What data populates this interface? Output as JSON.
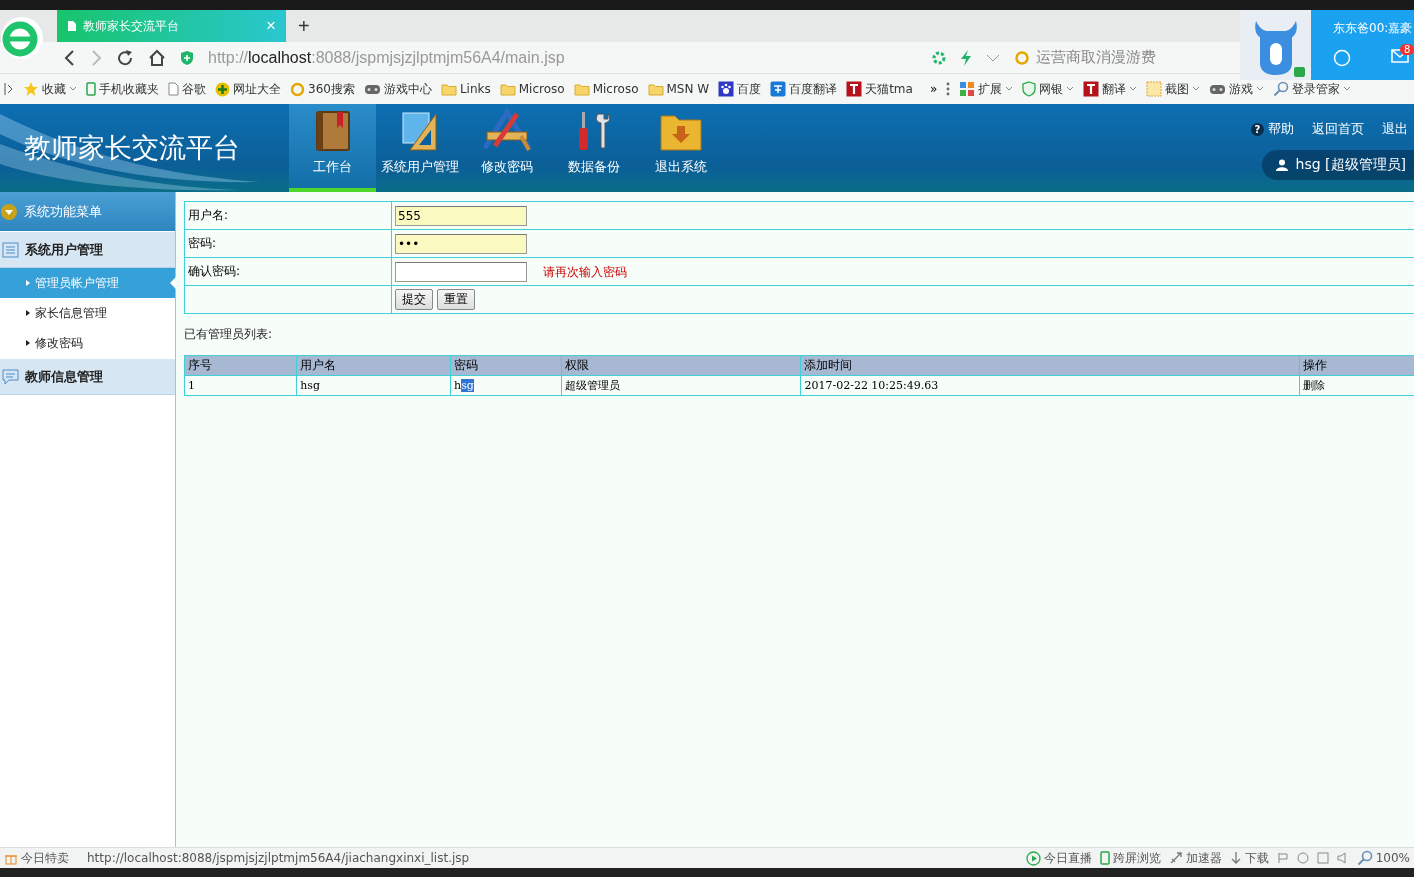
{
  "browser": {
    "tab_title": "教师家长交流平台",
    "new_tab": "+",
    "close": "×",
    "address": {
      "scheme": "http://",
      "host": "localhost",
      "path": ":8088/jspmjsjzjlptmjm56A4/main.jsp"
    },
    "search_hint": "运营商取消漫游费",
    "bookmarks": [
      {
        "kind": "star",
        "label": "收藏",
        "dropdown": true
      },
      {
        "kind": "phone",
        "label": "手机收藏夹",
        "dropdown": false
      },
      {
        "kind": "page",
        "label": "谷歌",
        "dropdown": false
      },
      {
        "kind": "plus",
        "label": "网址大全",
        "dropdown": false
      },
      {
        "kind": "ring",
        "label": "360搜索",
        "dropdown": false
      },
      {
        "kind": "gamepad",
        "label": "游戏中心",
        "dropdown": false
      },
      {
        "kind": "folder",
        "label": "Links",
        "dropdown": false
      },
      {
        "kind": "folder",
        "label": "Microso",
        "dropdown": false
      },
      {
        "kind": "folder",
        "label": "Microso",
        "dropdown": false
      },
      {
        "kind": "folder",
        "label": "MSN W",
        "dropdown": false
      },
      {
        "kind": "paw",
        "label": "百度",
        "dropdown": false
      },
      {
        "kind": "bluesq",
        "label": "百度翻译",
        "dropdown": false
      },
      {
        "kind": "redsq",
        "label": "天猫tma",
        "dropdown": false
      }
    ],
    "more": "»",
    "tools": [
      {
        "kind": "grid",
        "label": "扩展"
      },
      {
        "kind": "shield",
        "label": "网银"
      },
      {
        "kind": "redsq",
        "label": "翻译"
      },
      {
        "kind": "crop",
        "label": "截图"
      },
      {
        "kind": "gamepad",
        "label": "游戏"
      },
      {
        "kind": "search",
        "label": "登录管家"
      }
    ]
  },
  "notification": {
    "name": "东东爸00:嘉豪",
    "badge": "8"
  },
  "app": {
    "title": "教师家长交流平台",
    "nav": [
      {
        "kind": "book",
        "label": "工作台",
        "selected": true
      },
      {
        "kind": "ruler",
        "label": "系统用户管理",
        "selected": false
      },
      {
        "kind": "pencil",
        "label": "修改密码",
        "selected": false
      },
      {
        "kind": "tools",
        "label": "数据备份",
        "selected": false
      },
      {
        "kind": "folder",
        "label": "退出系统",
        "selected": false
      }
    ],
    "help_mark": "?",
    "links": [
      "帮助",
      "返回首页",
      "退出"
    ],
    "user": "hsg [超级管理员]"
  },
  "sidebar": {
    "header": "系统功能菜单",
    "groups": [
      {
        "kind": "list",
        "label": "系统用户管理",
        "children": [
          {
            "label": "管理员帐户管理",
            "selected": true
          },
          {
            "label": "家长信息管理",
            "selected": false
          },
          {
            "label": "修改密码",
            "selected": false
          }
        ]
      },
      {
        "kind": "chat",
        "label": "教师信息管理"
      }
    ]
  },
  "form": {
    "rows": [
      {
        "kind": "input",
        "label": "用户名:",
        "value": "555",
        "filled": true
      },
      {
        "kind": "input",
        "label": "密码:",
        "value": "•••",
        "filled": true
      },
      {
        "kind": "input",
        "label": "确认密码:",
        "value": "",
        "filled": false,
        "hint": "请再次输入密码"
      },
      {
        "kind": "buttons",
        "label": "",
        "buttons": [
          "提交",
          "重置"
        ]
      }
    ]
  },
  "list_title": "已有管理员列表:",
  "table": {
    "columns": [
      "序号",
      "用户名",
      "密码",
      "权限",
      "添加时间",
      "操作"
    ],
    "rows": [
      [
        [
          {
            "text": "1",
            "selected": false
          }
        ],
        [
          {
            "text": "hsg",
            "selected": false
          }
        ],
        [
          {
            "text": "h",
            "selected": false
          },
          {
            "text": "sg",
            "selected": true
          }
        ],
        [
          {
            "text": "超级管理员",
            "selected": false
          }
        ],
        [
          {
            "text": "2017-02-22 10:25:49.63",
            "selected": false
          }
        ],
        [
          {
            "text": "删除",
            "selected": false
          }
        ]
      ]
    ]
  },
  "status_bar": {
    "left": "今日特卖",
    "url": "http://localhost:8088/jspmjsjzjlptmjm56A4/jiachangxinxi_list.jsp",
    "items": [
      {
        "kind": "play",
        "label": "今日直播"
      },
      {
        "kind": "phone",
        "label": "跨屏浏览"
      },
      {
        "kind": "speed",
        "label": "加速器"
      },
      {
        "kind": "down",
        "label": "下载"
      }
    ],
    "zoom": "100%"
  }
}
